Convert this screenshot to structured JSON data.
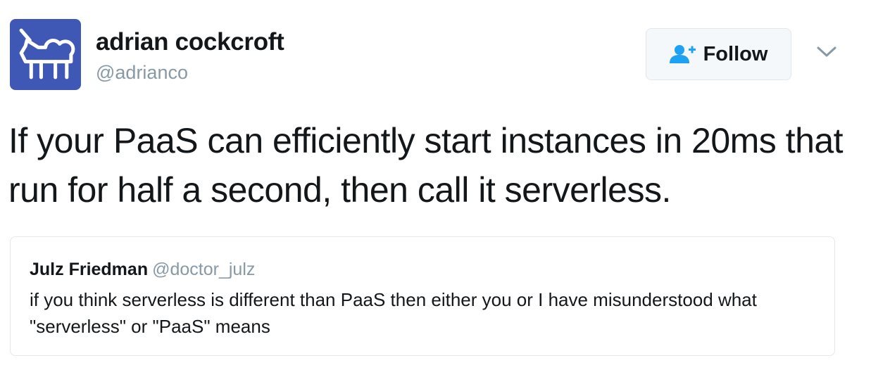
{
  "author": {
    "display_name": "adrian cockcroft",
    "username": "@adrianco",
    "avatar_icon": "unicorn-cloud-icon",
    "avatar_color": "#3f57b5"
  },
  "follow_button": {
    "label": "Follow",
    "icon": "follow-user-icon",
    "icon_color": "#1da1f2"
  },
  "menu": {
    "icon": "chevron-down-icon"
  },
  "tweet": {
    "text": "If your PaaS can efficiently start instances in 20ms that run for half a second, then call it serverless."
  },
  "quoted_tweet": {
    "display_name": "Julz Friedman",
    "username": "@doctor_julz",
    "text": "if you think serverless is different than PaaS then either you or I have misunderstood what \"serverless\" or \"PaaS\" means"
  }
}
